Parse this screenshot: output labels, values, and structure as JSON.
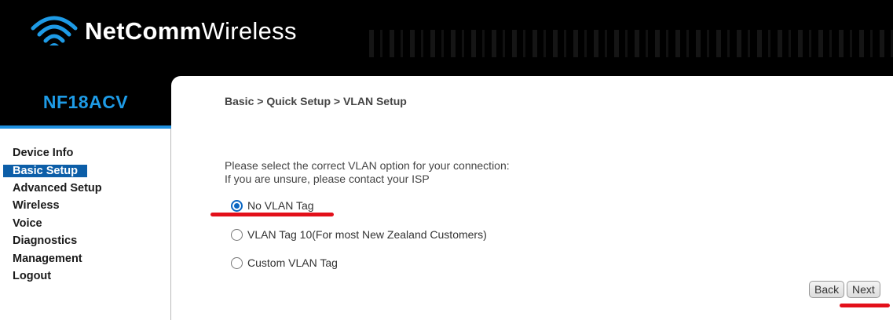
{
  "brand": {
    "name_bold": "NetComm",
    "name_light": "Wireless",
    "icon": "wifi-wave-icon"
  },
  "model": "NF18ACV",
  "sidebar": {
    "items": [
      {
        "label": "Device Info"
      },
      {
        "label": "Basic Setup",
        "active": true
      },
      {
        "label": "Advanced Setup"
      },
      {
        "label": "Wireless"
      },
      {
        "label": "Voice"
      },
      {
        "label": "Diagnostics"
      },
      {
        "label": "Management"
      },
      {
        "label": "Logout"
      }
    ]
  },
  "main": {
    "breadcrumb": "Basic > Quick Setup > VLAN Setup",
    "intro_line1": "Please select the correct VLAN option for your connection:",
    "intro_line2": "If you are unsure, please contact your ISP",
    "options": [
      {
        "label": "No VLAN Tag",
        "checked": true
      },
      {
        "label": "VLAN Tag 10(For most New Zealand Customers)",
        "checked": false
      },
      {
        "label": "Custom VLAN Tag",
        "checked": false
      }
    ],
    "back_label": "Back",
    "next_label": "Next"
  },
  "colors": {
    "accent": "#0c5ea8",
    "model_text": "#1e9be6",
    "annotation": "#e3101a"
  }
}
